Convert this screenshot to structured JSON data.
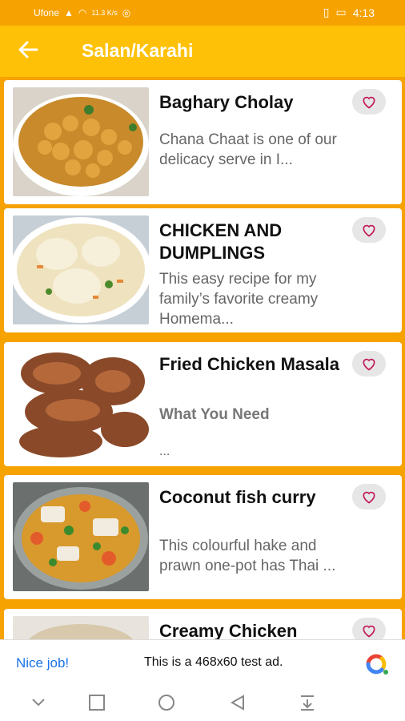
{
  "status": {
    "carrier": "Ufone",
    "speed": "11.3 K/s",
    "time": "4:13"
  },
  "appbar": {
    "title": "Salan/Karahi"
  },
  "recipes": [
    {
      "title": "Baghary Cholay",
      "desc": "Chana Chaat is one of our delicacy serve in I..."
    },
    {
      "title": "CHICKEN AND DUMPLINGS",
      "desc": "This easy recipe for my family’s favorite creamy Homema..."
    },
    {
      "title": "Fried Chicken Masala",
      "desc": "What You Need",
      "desc2": "..."
    },
    {
      "title": "Coconut fish curry",
      "desc": "This colourful hake and prawn one-pot has Thai ..."
    },
    {
      "title": "Creamy Chicken",
      "desc": ""
    }
  ],
  "ad": {
    "nice": "Nice job!",
    "text": "This is a 468x60 test ad."
  },
  "colors": {
    "primary": "#ffc107",
    "status": "#f6a200"
  }
}
